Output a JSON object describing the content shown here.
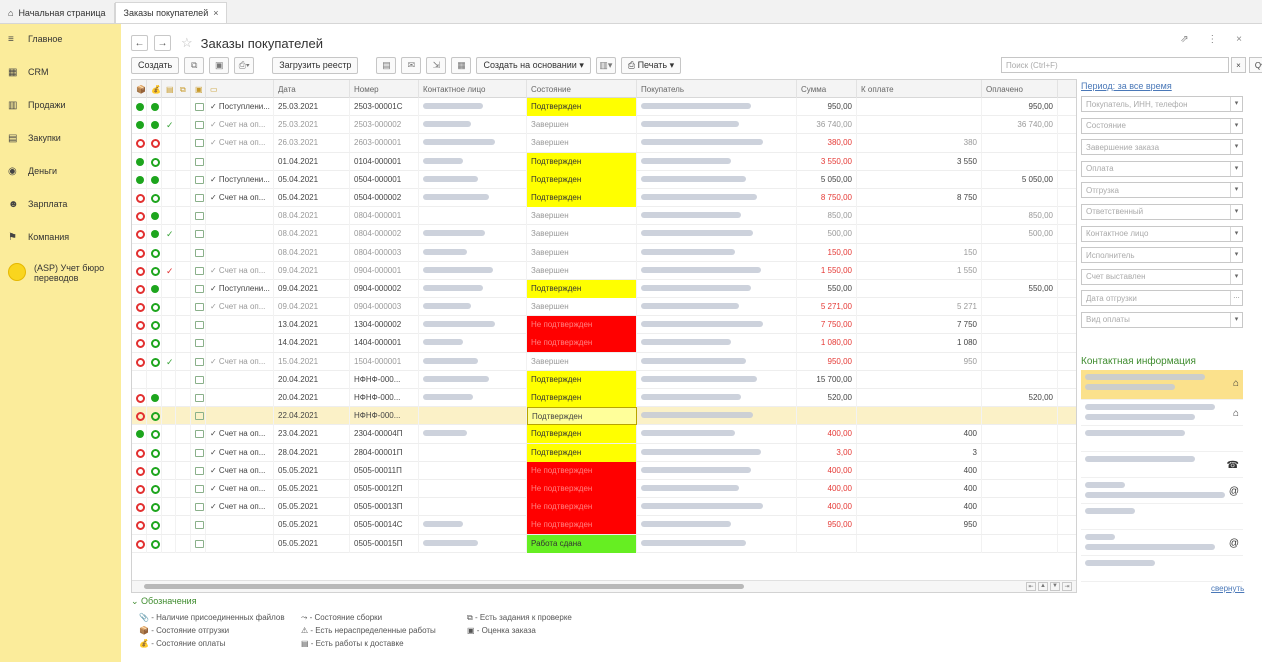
{
  "tabs": [
    {
      "label": "Начальная страница",
      "icon": "home-icon"
    },
    {
      "label": "Заказы покупателей",
      "close": "×"
    }
  ],
  "sidebar": {
    "items": [
      {
        "label": "Главное",
        "icon": "≡"
      },
      {
        "label": "CRM",
        "icon": "▦"
      },
      {
        "label": "Продажи",
        "icon": "▥"
      },
      {
        "label": "Закупки",
        "icon": "▤"
      },
      {
        "label": "Деньги",
        "icon": "◉"
      },
      {
        "label": "Зарплата",
        "icon": "☻"
      },
      {
        "label": "Компания",
        "icon": "⚑"
      }
    ],
    "asp_label": "(ASP) Учет бюро переводов"
  },
  "window": {
    "title": "Заказы покупателей",
    "controls": "⇗ ⋮ ×"
  },
  "toolbar": {
    "create": "Создать",
    "load_registry": "Загрузить реестр",
    "create_based_on": "Создать на основании",
    "print": "Печать",
    "search_placeholder": "Поиск (Ctrl+F)",
    "search_clear": "×",
    "search_btn": "Q",
    "more": "Еще"
  },
  "columns": [
    "Дата",
    "Номер",
    "Контактное лицо",
    "Состояние",
    "Покупатель",
    "Сумма",
    "К оплате",
    "Оплачено"
  ],
  "rows": [
    {
      "d1": "f",
      "d2": "f",
      "chk": "",
      "icon": "sq",
      "status": "✓ Поступлени...",
      "date": "25.03.2021",
      "num": "2503-00001С",
      "state": "Подтвержден",
      "sc": "yellow",
      "sum": "950,00",
      "red": false,
      "topay": "",
      "paid": "950,00",
      "muted": false
    },
    {
      "d1": "f",
      "d2": "f",
      "chk": "g",
      "icon": "sq",
      "status": "✓ Счет на оп...",
      "date": "25.03.2021",
      "num": "2503-000002",
      "state": "Завершен",
      "sc": "",
      "sum": "36 740,00",
      "red": false,
      "topay": "",
      "paid": "36 740,00",
      "muted": true
    },
    {
      "d1": "o",
      "d2": "o",
      "chk": "",
      "icon": "sq",
      "status": "✓ Счет на оп...",
      "date": "26.03.2021",
      "num": "2603-000001",
      "state": "Завершен",
      "sc": "",
      "sum": "380,00",
      "red": true,
      "topay": "380",
      "paid": "",
      "muted": true
    },
    {
      "d1": "f",
      "d2": "og",
      "chk": "",
      "icon": "sq",
      "status": "",
      "date": "01.04.2021",
      "num": "0104-000001",
      "state": "Подтвержден",
      "sc": "yellow",
      "sum": "3 550,00",
      "red": true,
      "topay": "3 550",
      "paid": "",
      "muted": false
    },
    {
      "d1": "f",
      "d2": "f",
      "chk": "",
      "icon": "sq",
      "status": "✓ Поступлени...",
      "date": "05.04.2021",
      "num": "0504-000001",
      "state": "Подтвержден",
      "sc": "yellow",
      "sum": "5 050,00",
      "red": false,
      "topay": "",
      "paid": "5 050,00",
      "muted": false
    },
    {
      "d1": "o",
      "d2": "og",
      "chk": "",
      "icon": "sq",
      "status": "✓ Счет на оп...",
      "date": "05.04.2021",
      "num": "0504-000002",
      "state": "Подтвержден",
      "sc": "yellow",
      "sum": "8 750,00",
      "red": true,
      "topay": "8 750",
      "paid": "",
      "muted": false
    },
    {
      "d1": "o",
      "d2": "f",
      "chk": "",
      "icon": "sq",
      "status": "",
      "date": "08.04.2021",
      "num": "0804-000001",
      "state": "Завершен",
      "sc": "",
      "sum": "850,00",
      "red": false,
      "topay": "",
      "paid": "850,00",
      "muted": true
    },
    {
      "d1": "o",
      "d2": "f",
      "chk": "g",
      "icon": "sq",
      "status": "",
      "date": "08.04.2021",
      "num": "0804-000002",
      "state": "Завершен",
      "sc": "",
      "sum": "500,00",
      "red": false,
      "topay": "",
      "paid": "500,00",
      "muted": true
    },
    {
      "d1": "o",
      "d2": "og",
      "chk": "",
      "icon": "sq",
      "status": "",
      "date": "08.04.2021",
      "num": "0804-000003",
      "state": "Завершен",
      "sc": "",
      "sum": "150,00",
      "red": true,
      "topay": "150",
      "paid": "",
      "muted": true
    },
    {
      "d1": "o",
      "d2": "og",
      "chk": "r",
      "icon": "sq",
      "status": "✓ Счет на оп...",
      "date": "09.04.2021",
      "num": "0904-000001",
      "state": "Завершен",
      "sc": "",
      "sum": "1 550,00",
      "red": true,
      "topay": "1 550",
      "paid": "",
      "muted": true
    },
    {
      "d1": "o",
      "d2": "f",
      "chk": "",
      "icon": "sq",
      "status": "✓ Поступлени...",
      "date": "09.04.2021",
      "num": "0904-000002",
      "state": "Подтвержден",
      "sc": "yellow",
      "sum": "550,00",
      "red": false,
      "topay": "",
      "paid": "550,00",
      "muted": false
    },
    {
      "d1": "o",
      "d2": "og",
      "chk": "",
      "icon": "sq",
      "status": "✓ Счет на оп...",
      "date": "09.04.2021",
      "num": "0904-000003",
      "state": "Завершен",
      "sc": "",
      "sum": "5 271,00",
      "red": true,
      "topay": "5 271",
      "paid": "",
      "muted": true
    },
    {
      "d1": "o",
      "d2": "og",
      "chk": "",
      "icon": "sq",
      "status": "",
      "date": "13.04.2021",
      "num": "1304-000002",
      "state": "Не подтвержден",
      "sc": "red",
      "sum": "7 750,00",
      "red": true,
      "topay": "7 750",
      "paid": "",
      "muted": false
    },
    {
      "d1": "o",
      "d2": "og",
      "chk": "",
      "icon": "sq",
      "status": "",
      "date": "14.04.2021",
      "num": "1404-000001",
      "state": "Не подтвержден",
      "sc": "red",
      "sum": "1 080,00",
      "red": true,
      "topay": "1 080",
      "paid": "",
      "muted": false
    },
    {
      "d1": "o",
      "d2": "og",
      "chk": "g",
      "icon": "sq",
      "status": "✓ Счет на оп...",
      "date": "15.04.2021",
      "num": "1504-000001",
      "state": "Завершен",
      "sc": "",
      "sum": "950,00",
      "red": true,
      "topay": "950",
      "paid": "",
      "muted": true
    },
    {
      "d1": "",
      "d2": "",
      "chk": "",
      "icon": "sq",
      "status": "",
      "date": "20.04.2021",
      "num": "НФНФ-000...",
      "state": "Подтвержден",
      "sc": "yellow",
      "sum": "15 700,00",
      "red": false,
      "topay": "",
      "paid": "",
      "muted": false
    },
    {
      "d1": "o",
      "d2": "f",
      "chk": "",
      "icon": "sq",
      "status": "",
      "date": "20.04.2021",
      "num": "НФНФ-000...",
      "state": "Подтвержден",
      "sc": "yellow",
      "sum": "520,00",
      "red": false,
      "topay": "",
      "paid": "520,00",
      "muted": false
    },
    {
      "d1": "o",
      "d2": "og",
      "chk": "",
      "icon": "sq",
      "status": "",
      "date": "22.04.2021",
      "num": "НФНФ-000...",
      "state": "Подтвержден",
      "sc": "selected",
      "sum": "",
      "red": false,
      "topay": "",
      "paid": "",
      "muted": false,
      "sel": true
    },
    {
      "d1": "f",
      "d2": "og",
      "chk": "",
      "icon": "sq",
      "status": "✓ Счет на оп...",
      "date": "23.04.2021",
      "num": "2304-00004П",
      "state": "Подтвержден",
      "sc": "yellow",
      "sum": "400,00",
      "red": true,
      "topay": "400",
      "paid": "",
      "muted": false
    },
    {
      "d1": "o",
      "d2": "og",
      "chk": "",
      "icon": "sq",
      "status": "✓ Счет на оп...",
      "date": "28.04.2021",
      "num": "2804-00001П",
      "state": "Подтвержден",
      "sc": "yellow",
      "sum": "3,00",
      "red": true,
      "topay": "3",
      "paid": "",
      "muted": false
    },
    {
      "d1": "o",
      "d2": "og",
      "chk": "",
      "icon": "sq",
      "status": "✓ Счет на оп...",
      "date": "05.05.2021",
      "num": "0505-00011П",
      "state": "Не подтвержден",
      "sc": "red",
      "sum": "400,00",
      "red": true,
      "topay": "400",
      "paid": "",
      "muted": false
    },
    {
      "d1": "o",
      "d2": "og",
      "chk": "",
      "icon": "sq",
      "status": "✓ Счет на оп...",
      "date": "05.05.2021",
      "num": "0505-00012П",
      "state": "Не подтвержден",
      "sc": "red",
      "sum": "400,00",
      "red": true,
      "topay": "400",
      "paid": "",
      "muted": false
    },
    {
      "d1": "o",
      "d2": "og",
      "chk": "",
      "icon": "sq",
      "status": "✓ Счет на оп...",
      "date": "05.05.2021",
      "num": "0505-00013П",
      "state": "Не подтвержден",
      "sc": "red",
      "sum": "400,00",
      "red": true,
      "topay": "400",
      "paid": "",
      "muted": false
    },
    {
      "d1": "o",
      "d2": "og",
      "chk": "",
      "icon": "sq",
      "status": "",
      "date": "05.05.2021",
      "num": "0505-00014С",
      "state": "Не подтвержден",
      "sc": "red",
      "sum": "950,00",
      "red": true,
      "topay": "950",
      "paid": "",
      "muted": false
    },
    {
      "d1": "o",
      "d2": "og",
      "chk": "",
      "icon": "sq",
      "status": "",
      "date": "05.05.2021",
      "num": "0505-00015П",
      "state": "Работа сдана",
      "sc": "green",
      "sum": "",
      "red": false,
      "topay": "",
      "paid": "",
      "muted": false
    }
  ],
  "legend": {
    "title": "Обозначения",
    "col1": [
      "- Наличие присоединенных файлов",
      "- Состояние отгрузки",
      "- Состояние оплаты"
    ],
    "col2": [
      "- Состояние сборки",
      "- Есть нераспределенные работы",
      "- Есть работы к доставке"
    ],
    "col3": [
      "- Есть задания к проверке",
      "- Оценка заказа"
    ]
  },
  "filters": {
    "period": "Период: за все время",
    "fields": [
      "Покупатель, ИНН, телефон",
      "Состояние",
      "Завершение заказа",
      "Оплата",
      "Отгрузка",
      "Ответственный",
      "Контактное лицо",
      "Исполнитель",
      "Счет выставлен",
      "Дата отгрузки",
      "Вид оплаты"
    ],
    "contact_title": "Контактная информация",
    "collapse": "свернуть"
  }
}
